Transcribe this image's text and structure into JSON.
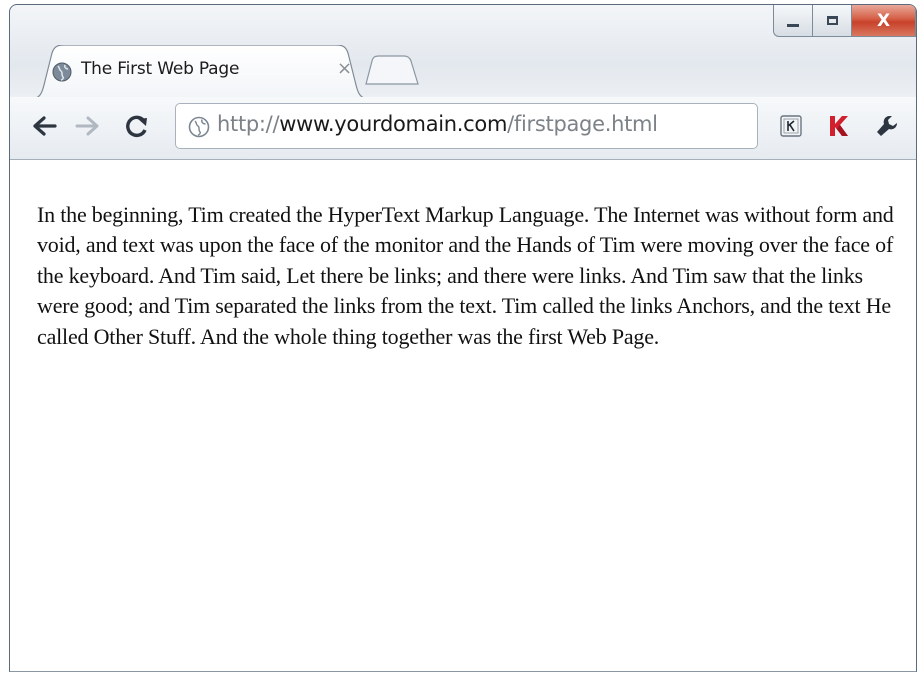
{
  "window": {
    "controls": {
      "minimize": "minimize",
      "maximize": "maximize",
      "close": "X"
    }
  },
  "tab": {
    "favicon": "globe-icon",
    "title": "The First Web Page",
    "close": "×"
  },
  "toolbar": {
    "back": "back-arrow-icon",
    "forward": "forward-arrow-icon",
    "reload": "reload-icon",
    "url": {
      "scheme": "http://",
      "host": "www.yourdomain.com",
      "path": "/firstpage.html"
    },
    "extensions": [
      "kaspersky-virtual-keyboard-icon",
      "kaspersky-icon",
      "wrench-icon"
    ]
  },
  "page": {
    "body_text": "In the beginning, Tim created the HyperText Markup Language. The Internet was without form and void, and text was upon the face of the monitor and the Hands of Tim were moving over the face of the keyboard. And Tim said, Let there be links; and there were links. And Tim saw that the links were good; and Tim separated the links from the text. Tim called the links Anchors, and the text He called Other Stuff. And the whole thing together was the first Web Page."
  },
  "colors": {
    "close_button": "#c8412a",
    "kaspersky_red": "#d1202e"
  }
}
